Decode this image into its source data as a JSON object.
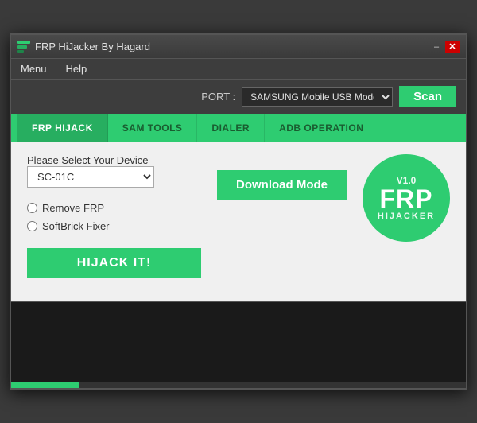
{
  "window": {
    "title": "FRP HiJacker By Hagard",
    "minimize_label": "–",
    "close_label": "✕"
  },
  "menu": {
    "items": [
      {
        "label": "Menu"
      },
      {
        "label": "Help"
      }
    ]
  },
  "port_bar": {
    "port_label": "PORT :",
    "port_value": "SAMSUNG Mobile USB Modem (v",
    "scan_label": "Scan"
  },
  "tabs": [
    {
      "id": "frp-hijack",
      "label": "FRP HIJACK",
      "active": true
    },
    {
      "id": "sam-tools",
      "label": "SAM TOOLS",
      "active": false
    },
    {
      "id": "dialer",
      "label": "DIALER",
      "active": false
    },
    {
      "id": "adb-operation",
      "label": "ADB OPERATION",
      "active": false
    }
  ],
  "content": {
    "device_label": "Please Select Your Device",
    "device_value": "SC-01C",
    "download_mode_label": "Download Mode",
    "options": [
      {
        "id": "remove-frp",
        "label": "Remove FRP"
      },
      {
        "id": "softbrick-fixer",
        "label": "SoftBrick Fixer"
      }
    ],
    "hijack_btn_label": "HIJACK IT!",
    "logo": {
      "version": "V1.0",
      "frp": "FRP",
      "sub": "HIJACKER"
    }
  },
  "output": {
    "text": "",
    "progress": 15
  }
}
